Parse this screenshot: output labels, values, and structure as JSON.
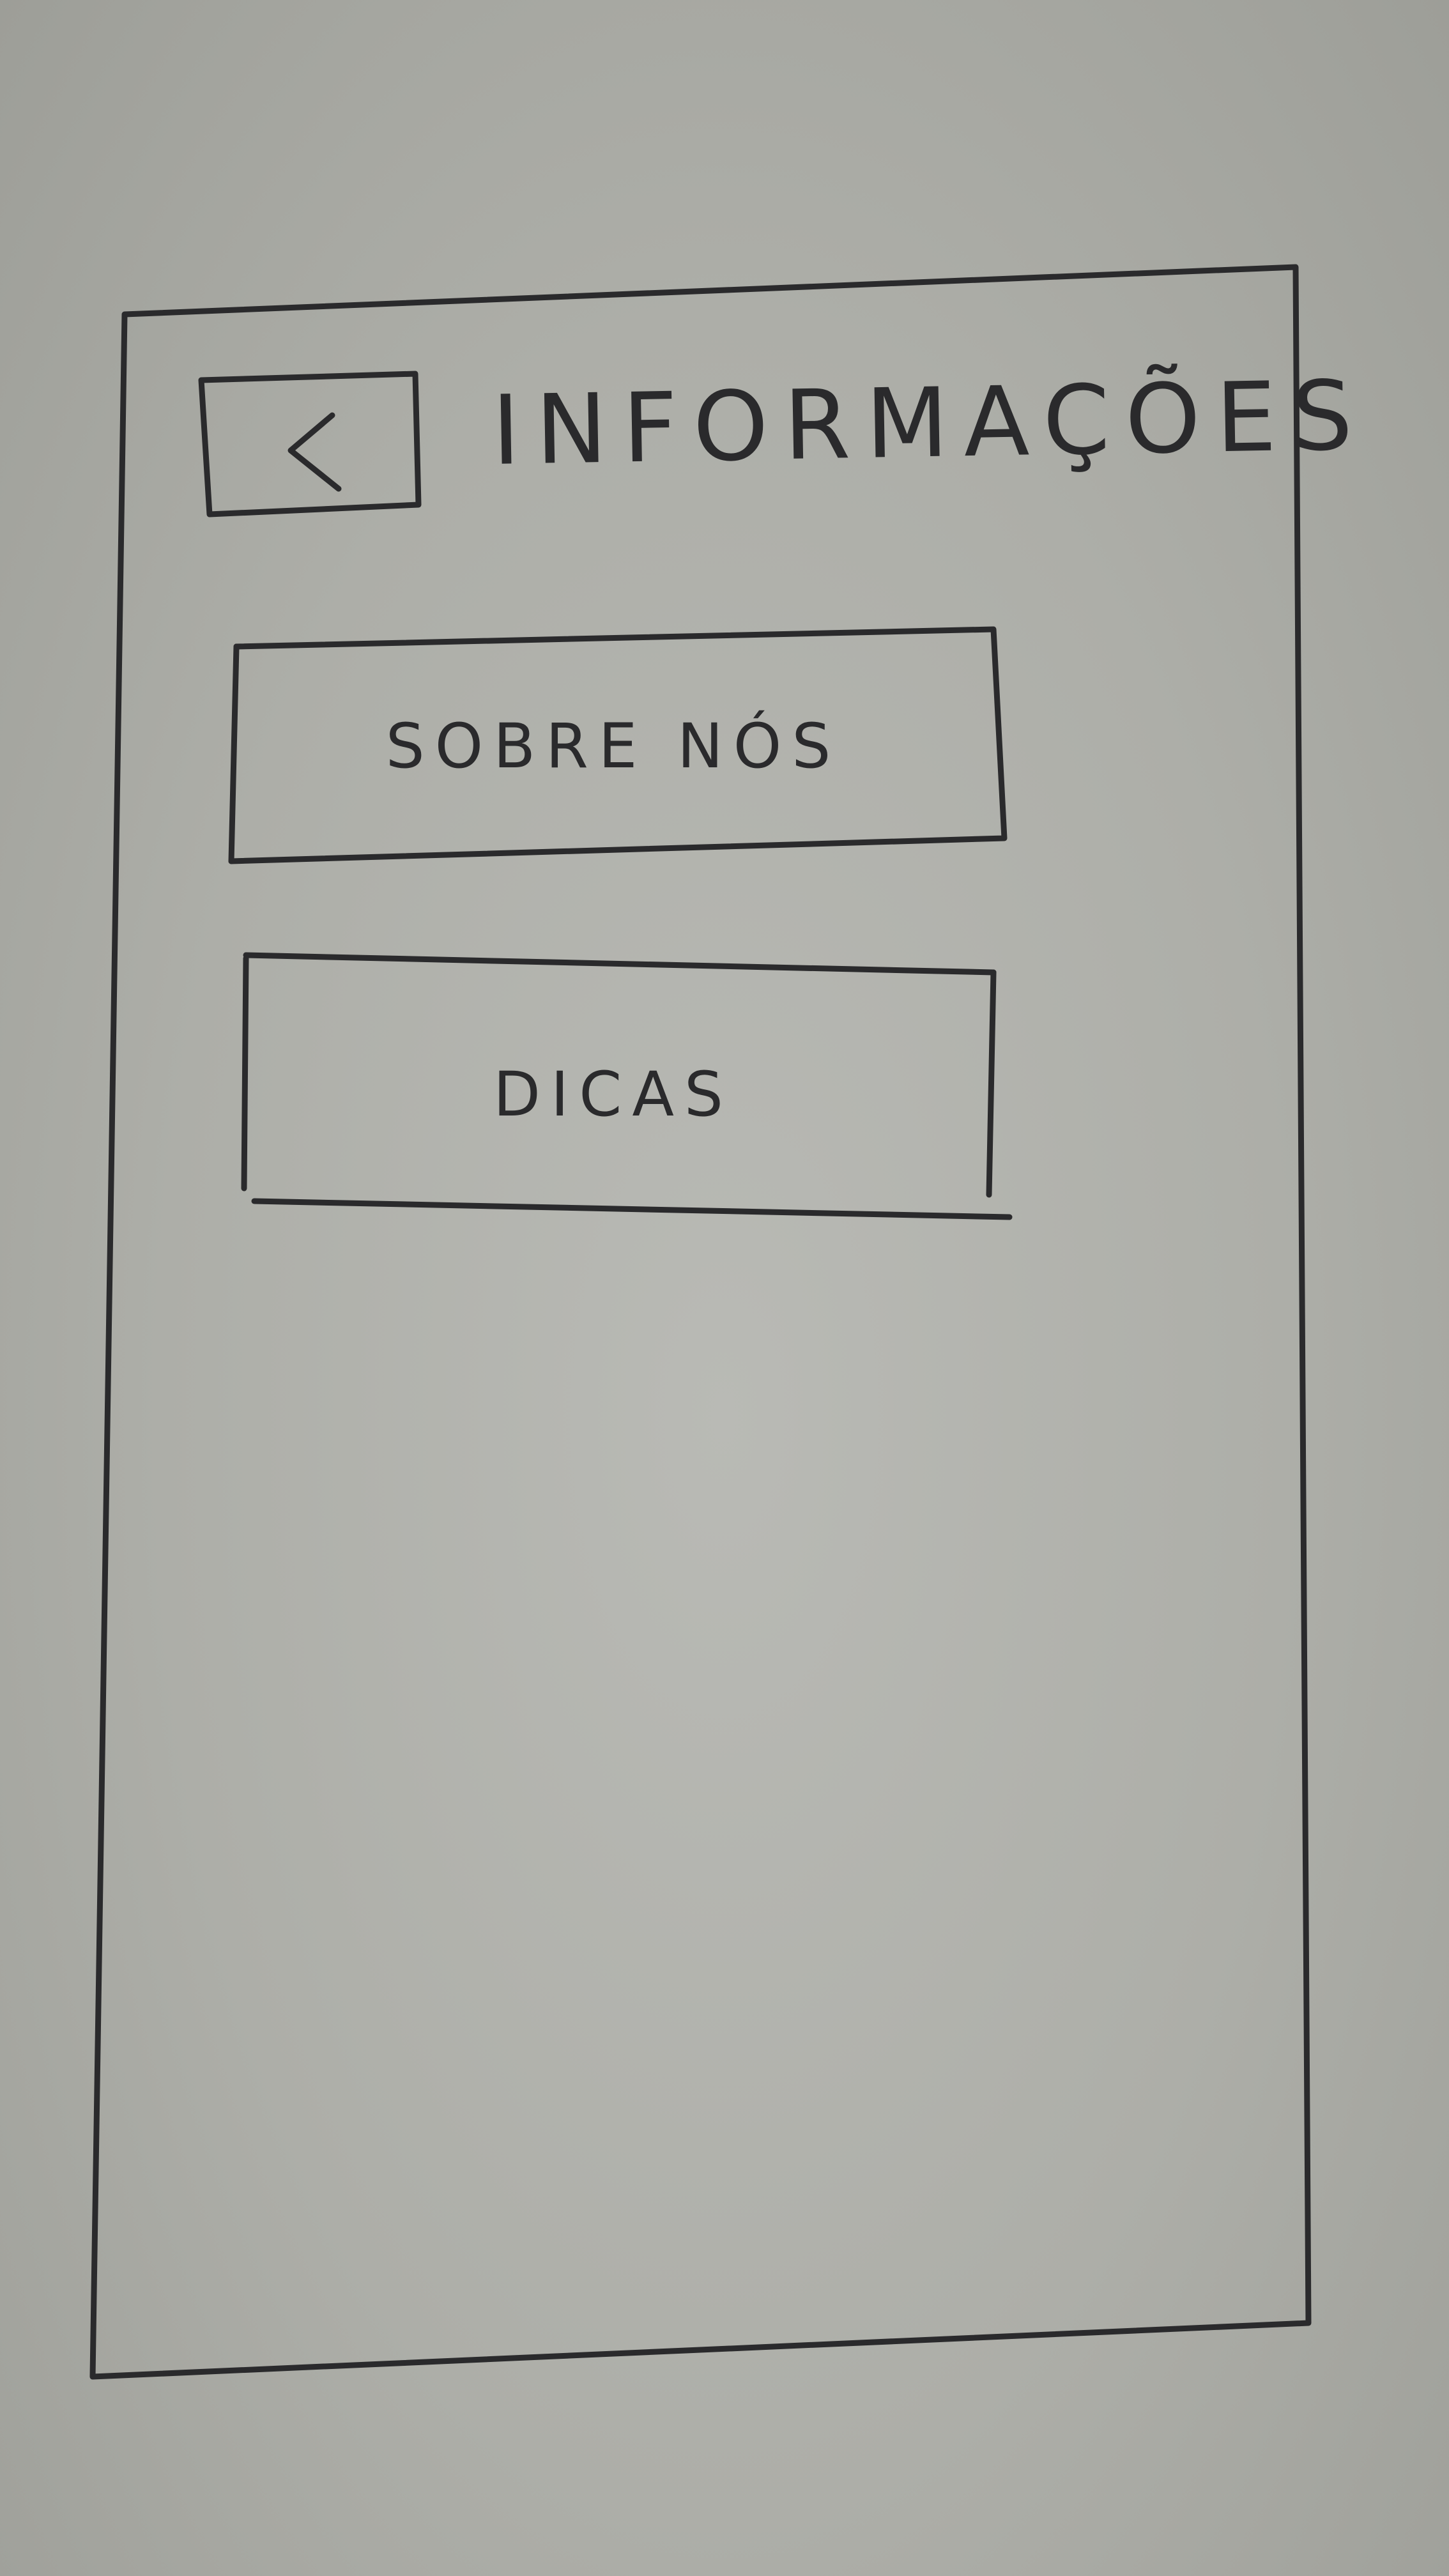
{
  "header": {
    "back_icon": "chevron-left-icon",
    "title": "INFORMAÇÕES"
  },
  "menu": {
    "items": [
      {
        "label": "SOBRE NÓS"
      },
      {
        "label": "DICAS"
      }
    ]
  },
  "colors": {
    "ink": "#2a2a2c",
    "paper": "#b9bab5"
  }
}
